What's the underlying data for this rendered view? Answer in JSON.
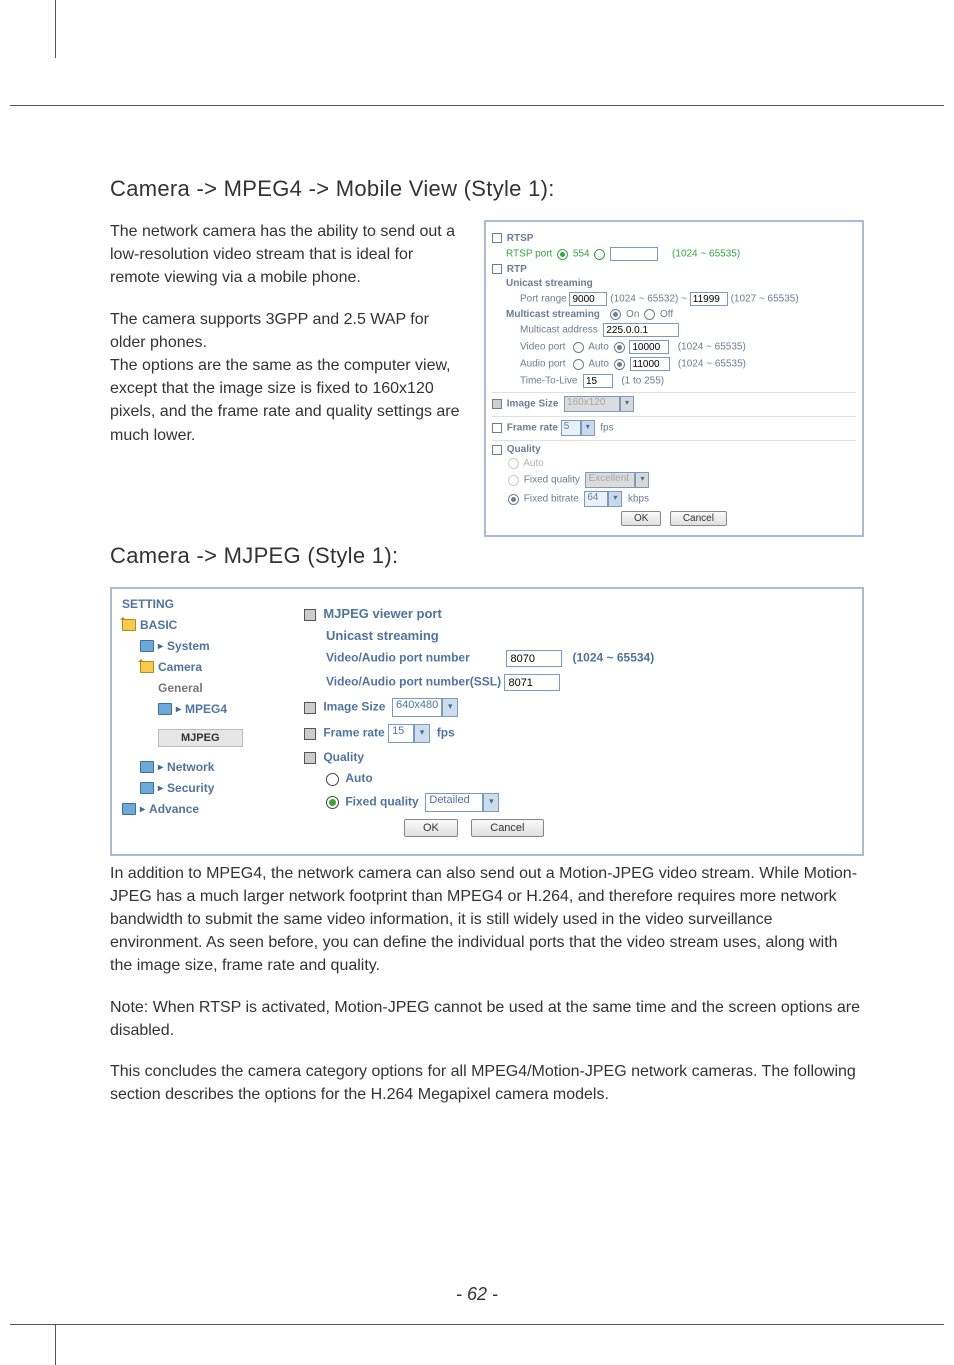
{
  "headings": {
    "mobile_view": "Camera -> MPEG4 -> Mobile View (Style 1):",
    "mjpeg": "Camera -> MJPEG (Style 1):"
  },
  "paragraphs": {
    "p1": "The network camera has the ability to send out a low-resolution video stream that is ideal for remote viewing via a mobile phone.",
    "p2": "The camera supports 3GPP and 2.5 WAP for older phones.",
    "p3": "The options are the same as the computer view, except that the image size is fixed to 160x120 pixels, and the frame rate and quality settings are much lower.",
    "p4": "In addition to MPEG4, the network camera can also send out a Motion-JPEG video stream. While Motion-JPEG has a much larger network footprint than MPEG4 or H.264, and therefore requires more network bandwidth to submit the same video information, it is still widely used in the video surveillance environment. As seen before, you can define the individual ports that the video stream uses, along with the image size, frame rate and quality.",
    "p5": "Note: When RTSP is activated, Motion-JPEG cannot be used at the same time and the screen options are disabled.",
    "p6": "This concludes the camera category options for all MPEG4/Motion-JPEG network cameras. The following section describes the options for the H.264 Megapixel camera models."
  },
  "mobile_panel": {
    "rtsp_label": "RTSP",
    "rtsp_port_label": "RTSP port",
    "rtsp_port_default": "554",
    "rtsp_port_value": "",
    "rtsp_port_range": "(1024 ~ 65535)",
    "rtp_label": "RTP",
    "unicast_label": "Unicast streaming",
    "port_range_label": "Port range",
    "port_range_from": "9000",
    "port_range_from_hint": "(1024 ~ 65532) ~",
    "port_range_to": "11999",
    "port_range_to_hint": "(1027 ~ 65535)",
    "multicast_label": "Multicast streaming",
    "on": "On",
    "off": "Off",
    "multicast_addr_label": "Multicast address",
    "multicast_addr": "225.0.0.1",
    "video_port_label": "Video port",
    "auto": "Auto",
    "video_port": "10000",
    "vp_hint": "(1024 ~ 65535)",
    "audio_port_label": "Audio port",
    "audio_port": "11000",
    "ap_hint": "(1024 ~ 65535)",
    "ttl_label": "Time-To-Live",
    "ttl": "15",
    "ttl_hint": "(1 to 255)",
    "image_size_label": "Image Size",
    "image_size": "160x120",
    "frame_rate_label": "Frame rate",
    "frame_rate": "5",
    "fps": "fps",
    "quality_label": "Quality",
    "q_auto": "Auto",
    "q_fixed_quality": "Fixed quality",
    "q_fixed_quality_val": "Excellent",
    "q_fixed_bitrate": "Fixed bitrate",
    "q_fixed_bitrate_val": "64",
    "kbps": "kbps",
    "ok": "OK",
    "cancel": "Cancel"
  },
  "mjpeg_panel": {
    "side": {
      "setting": "SETTING",
      "basic": "BASIC",
      "system": "System",
      "camera": "Camera",
      "general": "General",
      "mpeg4": "MPEG4",
      "mjpeg": "MJPEG",
      "network": "Network",
      "security": "Security",
      "advance": "Advance"
    },
    "main": {
      "viewer_port": "MJPEG viewer port",
      "unicast": "Unicast streaming",
      "vap_label": "Video/Audio port number",
      "vap_value": "8070",
      "vap_hint": "(1024 ~ 65534)",
      "vap_ssl_label": "Video/Audio port number(SSL)",
      "vap_ssl_value": "8071",
      "image_size_label": "Image Size",
      "image_size": "640x480",
      "frame_rate_label": "Frame rate",
      "frame_rate": "15",
      "fps": "fps",
      "quality_label": "Quality",
      "auto": "Auto",
      "fixed_quality": "Fixed quality",
      "fixed_quality_val": "Detailed",
      "ok": "OK",
      "cancel": "Cancel"
    }
  },
  "footer": "- 62 -"
}
